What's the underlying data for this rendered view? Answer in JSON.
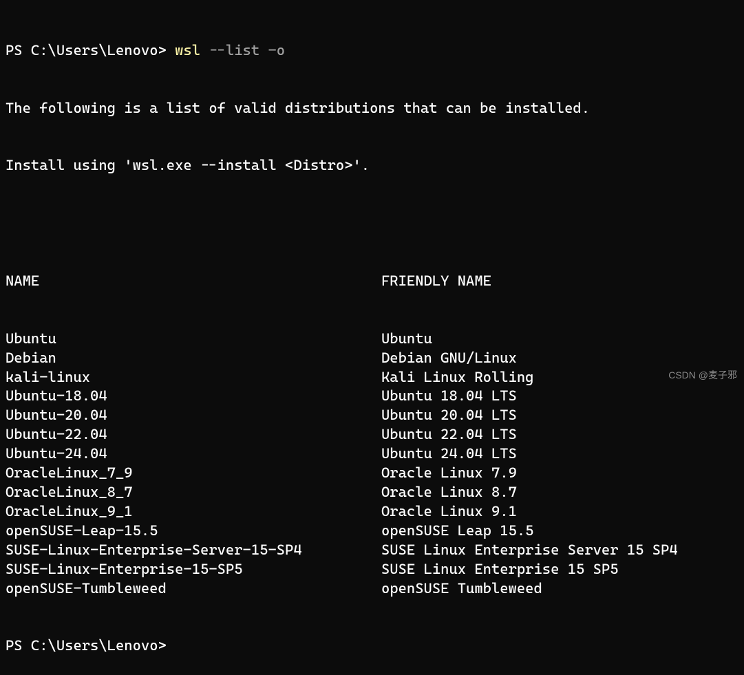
{
  "prompt1": {
    "ps": "PS ",
    "path": "C:\\Users\\Lenovo",
    "gt": "> ",
    "cmd": "wsl",
    "args": " --list -o"
  },
  "output": {
    "line1": "The following is a list of valid distributions that can be installed.",
    "line2": "Install using 'wsl.exe --install <Distro>'."
  },
  "headers": {
    "name": "NAME",
    "friendly": "FRIENDLY NAME"
  },
  "distros": [
    {
      "name": "Ubuntu",
      "friendly": "Ubuntu"
    },
    {
      "name": "Debian",
      "friendly": "Debian GNU/Linux"
    },
    {
      "name": "kali-linux",
      "friendly": "Kali Linux Rolling"
    },
    {
      "name": "Ubuntu-18.04",
      "friendly": "Ubuntu 18.04 LTS"
    },
    {
      "name": "Ubuntu-20.04",
      "friendly": "Ubuntu 20.04 LTS"
    },
    {
      "name": "Ubuntu-22.04",
      "friendly": "Ubuntu 22.04 LTS"
    },
    {
      "name": "Ubuntu-24.04",
      "friendly": "Ubuntu 24.04 LTS"
    },
    {
      "name": "OracleLinux_7_9",
      "friendly": "Oracle Linux 7.9"
    },
    {
      "name": "OracleLinux_8_7",
      "friendly": "Oracle Linux 8.7"
    },
    {
      "name": "OracleLinux_9_1",
      "friendly": "Oracle Linux 9.1"
    },
    {
      "name": "openSUSE-Leap-15.5",
      "friendly": "openSUSE Leap 15.5"
    },
    {
      "name": "SUSE-Linux-Enterprise-Server-15-SP4",
      "friendly": "SUSE Linux Enterprise Server 15 SP4"
    },
    {
      "name": "SUSE-Linux-Enterprise-15-SP5",
      "friendly": "SUSE Linux Enterprise 15 SP5"
    },
    {
      "name": "openSUSE-Tumbleweed",
      "friendly": "openSUSE Tumbleweed"
    }
  ],
  "prompt2": {
    "ps": "PS ",
    "path": "C:\\Users\\Lenovo",
    "gt": ">"
  },
  "watermark": "CSDN @麦子邪"
}
